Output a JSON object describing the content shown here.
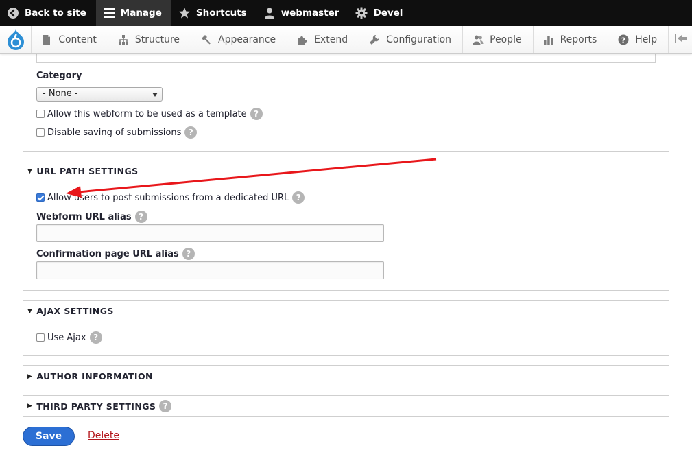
{
  "toolbar": {
    "back_to_site": "Back to site",
    "manage": "Manage",
    "shortcuts": "Shortcuts",
    "user": "webmaster",
    "devel": "Devel"
  },
  "tray": {
    "items": [
      {
        "label": "Content",
        "icon": "document-icon"
      },
      {
        "label": "Structure",
        "icon": "sitemap-icon"
      },
      {
        "label": "Appearance",
        "icon": "paintbrush-icon"
      },
      {
        "label": "Extend",
        "icon": "puzzle-icon"
      },
      {
        "label": "Configuration",
        "icon": "wrench-icon"
      },
      {
        "label": "People",
        "icon": "people-icon"
      },
      {
        "label": "Reports",
        "icon": "bar-chart-icon"
      },
      {
        "label": "Help",
        "icon": "question-icon"
      }
    ]
  },
  "general": {
    "category_label": "Category",
    "category_value": "- None -",
    "template_label": "Allow this webform to be used as a template",
    "disable_saving_label": "Disable saving of submissions"
  },
  "url_path": {
    "legend": "URL PATH SETTINGS",
    "dedicated_url_label": "Allow users to post submissions from a dedicated URL",
    "dedicated_url_checked": true,
    "alias_label": "Webform URL alias",
    "alias_value": "",
    "confirmation_label": "Confirmation page URL alias",
    "confirmation_value": ""
  },
  "ajax": {
    "legend": "AJAX SETTINGS",
    "use_ajax_label": "Use Ajax"
  },
  "author": {
    "legend": "AUTHOR INFORMATION"
  },
  "third_party": {
    "legend": "THIRD PARTY SETTINGS"
  },
  "help_glyph": "?",
  "actions": {
    "save": "Save",
    "delete": "Delete"
  },
  "colors": {
    "accent": "#2c6fd4",
    "annotation_arrow": "#e8171b",
    "delete_link": "#b4161b"
  }
}
